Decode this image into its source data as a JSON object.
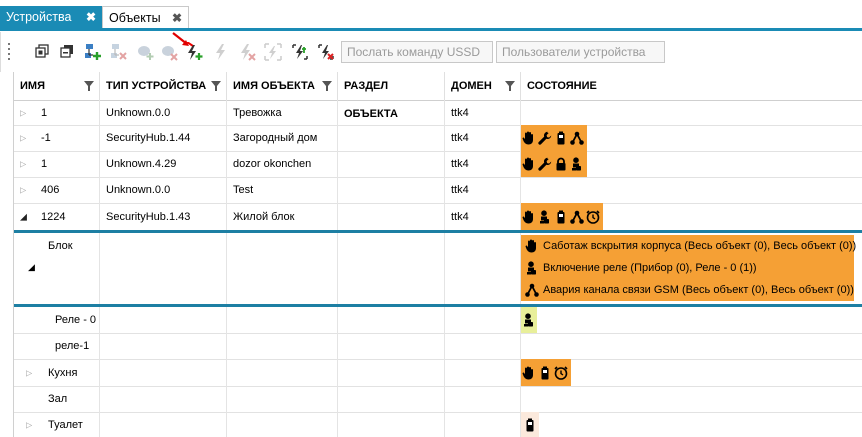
{
  "tabs": [
    {
      "label": "Устройства",
      "active": true
    },
    {
      "label": "Объекты",
      "active": false
    }
  ],
  "tab_close_glyph": "✖",
  "toolbar": {
    "ussd_button": "Послать команду USSD",
    "users_button": "Пользователи устройства"
  },
  "columns": {
    "name": "ИМЯ",
    "device_type": "ТИП УСТРОЙСТВА",
    "object_name": "ИМЯ ОБЪЕКТА",
    "object_section": "РАЗДЕЛ ОБЪЕКТА",
    "domain": "ДОМЕН",
    "state": "СОСТОЯНИЕ"
  },
  "rows": [
    {
      "name": "1",
      "device_type": "Unknown.0.0",
      "object_name": "Тревожка",
      "domain": "ttk4",
      "icons": []
    },
    {
      "name": "-1",
      "device_type": "SecurityHub.1.44",
      "object_name": "Загородный дом",
      "domain": "ttk4",
      "icons": [
        "hand-icon",
        "wrench-icon",
        "battery-icon",
        "network-icon"
      ]
    },
    {
      "name": "1",
      "device_type": "Unknown.4.29",
      "object_name": "dozor okonchen",
      "domain": "ttk4",
      "icons": [
        "hand-icon",
        "wrench-icon",
        "lock-icon",
        "relay-icon"
      ]
    },
    {
      "name": "406",
      "device_type": "Unknown.0.0",
      "object_name": "Test",
      "domain": "ttk4",
      "icons": []
    },
    {
      "name": "1224",
      "device_type": "SecurityHub.1.43",
      "object_name": "Жилой блок",
      "domain": "ttk4",
      "icons": [
        "hand-icon",
        "relay-icon",
        "battery-icon",
        "network-icon",
        "timer-icon"
      ]
    }
  ],
  "block": {
    "name": "Блок",
    "events": [
      {
        "icon": "hand-icon",
        "text": "Саботаж вскрытия корпуса (Весь объект (0), Весь объект (0))"
      },
      {
        "icon": "relay-icon",
        "text": "Включение реле (Прибор (0), Реле - 0 (1))"
      },
      {
        "icon": "network-icon",
        "text": "Авария канала связи GSM (Весь объект (0), Весь объект (0))"
      }
    ]
  },
  "children": [
    {
      "name": "Реле - 0",
      "icons": [
        "relay-icon"
      ],
      "status": "green"
    },
    {
      "name": "реле-1",
      "icons": []
    },
    {
      "name": "Кухня",
      "icons": [
        "hand-icon",
        "battery-icon",
        "timer-icon"
      ],
      "status": "orange"
    },
    {
      "name": "Зал",
      "icons": []
    },
    {
      "name": "Туалет",
      "icons": [
        "battery-icon"
      ],
      "status": "pale"
    }
  ],
  "colors": {
    "accent": "#1a8bb5",
    "status_orange": "#f5a035",
    "status_green": "#e8ef9a",
    "status_pale": "#fbe9dc"
  }
}
